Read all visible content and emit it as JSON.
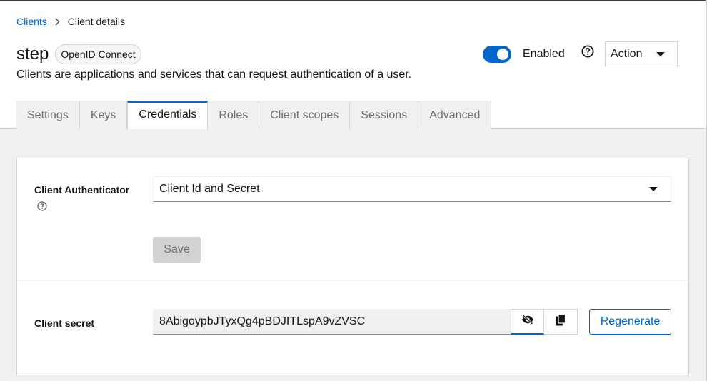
{
  "breadcrumb": {
    "parent": "Clients",
    "current": "Client details"
  },
  "header": {
    "title": "step",
    "protocol_badge": "OpenID Connect",
    "description": "Clients are applications and services that can request authentication of a user.",
    "enabled_label": "Enabled",
    "enabled": true,
    "action_label": "Action"
  },
  "tabs": [
    {
      "label": "Settings",
      "active": false
    },
    {
      "label": "Keys",
      "active": false
    },
    {
      "label": "Credentials",
      "active": true
    },
    {
      "label": "Roles",
      "active": false
    },
    {
      "label": "Client scopes",
      "active": false
    },
    {
      "label": "Sessions",
      "active": false
    },
    {
      "label": "Advanced",
      "active": false
    }
  ],
  "authenticator": {
    "label": "Client Authenticator",
    "value": "Client Id and Secret",
    "save_label": "Save"
  },
  "secret": {
    "label": "Client secret",
    "value": "8AbigoypbJTyxQg4pBDJITLspA9vZVSC",
    "regenerate_label": "Regenerate"
  },
  "icons": {
    "separator": "chevron-right-icon",
    "help": "question-circle-icon",
    "visibility": "eye-slash-icon",
    "copy": "copy-icon"
  },
  "colors": {
    "accent": "#0066cc",
    "tab_bg": "#f0f0f0",
    "border": "#d2d2d2"
  }
}
